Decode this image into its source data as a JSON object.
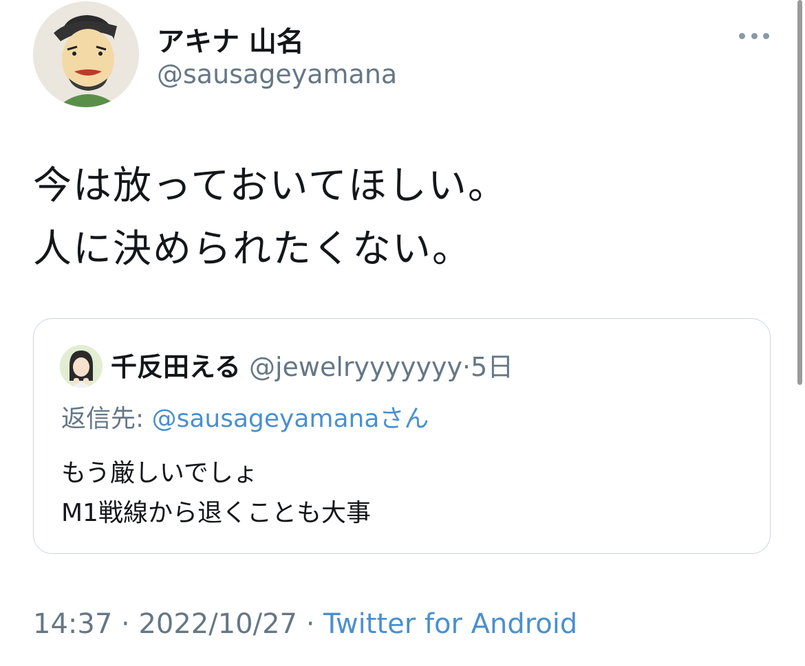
{
  "tweet": {
    "author": {
      "display_name": "アキナ 山名",
      "handle": "@sausageyamana",
      "avatar_icon": "cartoon-portrait-avatar"
    },
    "more_icon": "more-horizontal-icon",
    "text_lines": [
      "今は放っておいてほしい。",
      "人に決められたくない。"
    ],
    "quoted": {
      "display_name": "千反田える",
      "handle": "@jewelryyyyyyy",
      "separator": "·",
      "time": "5日",
      "reply_label": "返信先:",
      "reply_mention": "@sausageyamana",
      "reply_suffix": "さん",
      "body_lines": [
        "もう厳しいでしょ",
        "M1戦線から退くことも大事"
      ]
    },
    "meta": {
      "time": "14:37",
      "separator": "·",
      "date": "2022/10/27",
      "source": "Twitter for Android"
    }
  },
  "colors": {
    "text": "#14171a",
    "secondary": "#657786",
    "link": "#4a8fd0",
    "border": "#ccd6dd"
  }
}
